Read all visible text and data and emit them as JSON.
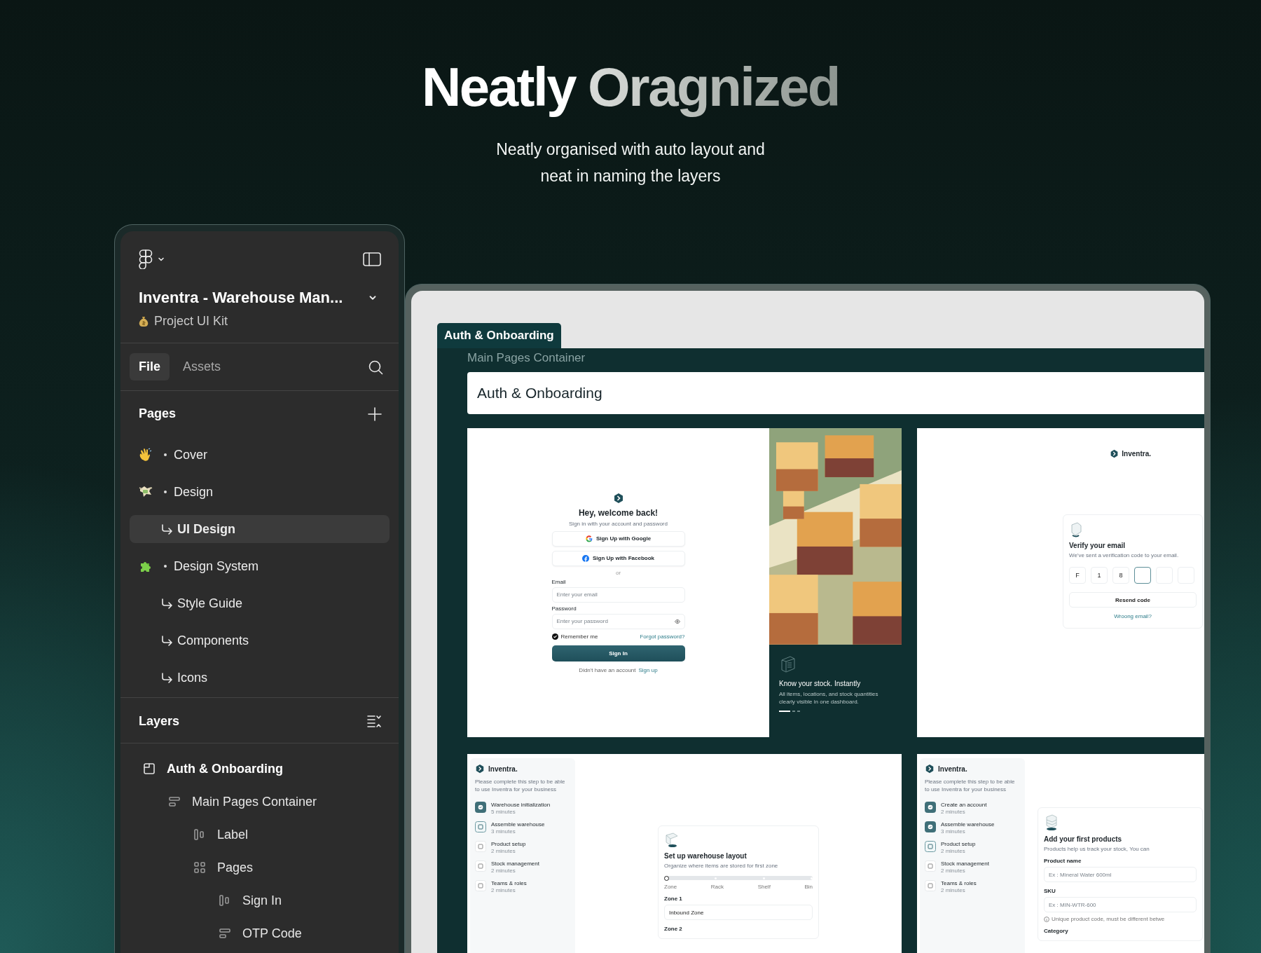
{
  "hero": {
    "title_lead": "Neatly",
    "title_rest": "Oragnized",
    "subtitle": "Neatly organised with auto layout and neat in naming the layers"
  },
  "panel": {
    "file_name": "Inventra - Warehouse Man...",
    "project": "Project UI Kit",
    "tabs": [
      {
        "label": "File",
        "selected": true
      },
      {
        "label": "Assets",
        "selected": false
      }
    ],
    "pages_heading": "Pages",
    "pages": [
      {
        "label": "Cover",
        "kind": "wave",
        "selected": false
      },
      {
        "label": "Design",
        "kind": "money",
        "selected": false,
        "children": [
          {
            "label": "UI Design",
            "selected": true
          }
        ]
      },
      {
        "label": "Design System",
        "kind": "puzzle",
        "selected": false,
        "children": [
          {
            "label": "Style Guide",
            "selected": false
          },
          {
            "label": "Components",
            "selected": false
          },
          {
            "label": "Icons",
            "selected": false
          }
        ]
      }
    ],
    "layers_heading": "Layers",
    "layers": [
      {
        "label": "Auth & Onboarding",
        "kind": "frame",
        "children": [
          {
            "label": "Main Pages Container",
            "kind": "stack",
            "children": [
              {
                "label": "Label",
                "kind": "column"
              },
              {
                "label": "Pages",
                "kind": "grid",
                "children": [
                  {
                    "label": "Sign In",
                    "kind": "column"
                  },
                  {
                    "label": "OTP Code",
                    "kind": "stack"
                  }
                ]
              }
            ]
          }
        ]
      }
    ]
  },
  "canvas": {
    "frame_label": "Auth & Onboarding",
    "container_label": "Main Pages Container",
    "header": "Auth & Onboarding",
    "sign_in": {
      "heading": "Hey, welcome back!",
      "subtitle": "Sign in with your account and password",
      "social": [
        {
          "label": "Sign Up with Google",
          "kind": "google"
        },
        {
          "label": "Sign Up with Facebook",
          "kind": "facebook"
        }
      ],
      "divider": "or",
      "fields": [
        {
          "label": "Email",
          "placeholder": "Enter your email",
          "kind": "text"
        },
        {
          "label": "Password",
          "placeholder": "Enter your password",
          "kind": "password"
        }
      ],
      "remember": {
        "label": "Remember me",
        "checked": true
      },
      "forgot": "Forgot password?",
      "submit": "Sign In",
      "footer_text": "Didn't have an account",
      "footer_link": "Sign up"
    },
    "promo": {
      "kind": "picture",
      "title": "Know your stock. Instantly",
      "body": "All items, locations, and stock quantities clearly visible in one dashboard.",
      "dots": [
        {
          "selected": true
        },
        {
          "selected": false
        },
        {
          "selected": false
        }
      ]
    },
    "verify": {
      "brand": "Inventra.",
      "title": "Verify your email",
      "subtitle": "We've sent a verification code to your email.",
      "cells": [
        {
          "value": "F",
          "focused": false
        },
        {
          "value": "1",
          "focused": false
        },
        {
          "value": "8",
          "focused": false
        },
        {
          "focused": true
        },
        {
          "focused": false
        },
        {
          "focused": false
        }
      ],
      "resend": "Resend code",
      "wrong_email": "Wroong email?"
    },
    "warehouse": {
      "brand": "Inventra.",
      "intro": "Please complete this step to be able to use Inventra for your business",
      "steps": [
        {
          "title": "Warehouse initialization",
          "duration": "5 minutes",
          "done": true,
          "current": false
        },
        {
          "title": "Assemble warehouse",
          "duration": "3 minutes",
          "done": false,
          "current": true
        },
        {
          "title": "Product setup",
          "duration": "2 minutes",
          "done": false,
          "current": false
        },
        {
          "title": "Stock management",
          "duration": "2 minutes",
          "done": false,
          "current": false
        },
        {
          "title": "Teams & roles",
          "duration": "2 minutes",
          "done": false,
          "current": false
        }
      ],
      "title": "Set up warehouse layout",
      "subtitle": "Organize where items are stored for first zone",
      "stops": [
        {
          "label": "Zone",
          "selected": true
        },
        {
          "label": "Rack",
          "selected": false
        },
        {
          "label": "Shelf",
          "selected": false
        },
        {
          "label": "Bin",
          "selected": false
        }
      ],
      "fields": [
        {
          "label": "Zone 1",
          "value": "Inbound Zone"
        },
        {
          "label": "Zone 2"
        }
      ]
    },
    "products": {
      "brand": "Inventra.",
      "intro": "Please complete this step to be able to use Inventra for your business",
      "steps": [
        {
          "title": "Create an account",
          "duration": "2 minutes",
          "done": true,
          "current": false
        },
        {
          "title": "Assemble warehouse",
          "duration": "3 minutes",
          "done": true,
          "current": false
        },
        {
          "title": "Product setup",
          "duration": "2 minutes",
          "done": false,
          "current": true
        },
        {
          "title": "Stock management",
          "duration": "2 minutes",
          "done": false,
          "current": false
        },
        {
          "title": "Teams & roles",
          "duration": "2 minutes",
          "done": false,
          "current": false
        }
      ],
      "title": "Add your first products",
      "subtitle": "Products help us track your stock, You can",
      "fields": [
        {
          "label": "Product name",
          "placeholder": "Ex : Mineral Water 600ml"
        },
        {
          "label": "SKU",
          "placeholder": "Ex : MIN-WTR-600",
          "hint": "Unique product code, must be different betwe"
        },
        {
          "label": "Category"
        }
      ]
    }
  }
}
